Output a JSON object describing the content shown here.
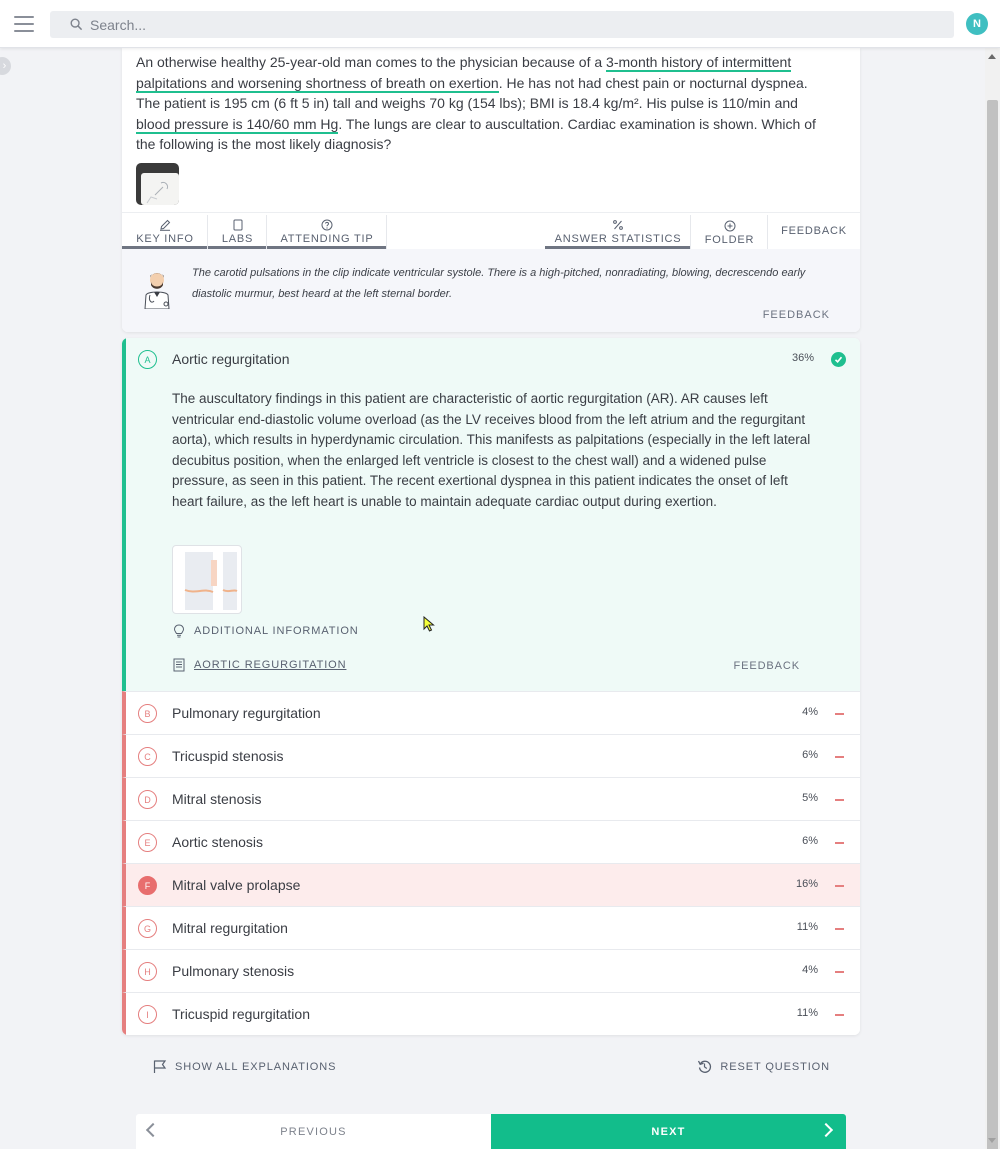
{
  "search": {
    "placeholder": "Search..."
  },
  "user": {
    "initial": "N"
  },
  "question": {
    "stem_parts": [
      "An otherwise healthy 25-year-old man comes to the physician because of a ",
      "3-month history of intermittent palpitations and worsening shortness of breath on exertion",
      ". He has not had chest pain or nocturnal dyspnea. The patient is 195 cm (6 ft 5 in) tall and weighs 70 kg (154 lbs); BMI is 18.4 kg/m². His pulse is 110/min and ",
      "blood pressure is 140/60 mm Hg",
      ". The lungs are clear to auscultation. Cardiac examination is shown. Which of the following is the most likely diagnosis?"
    ]
  },
  "tabs": {
    "key_info": "KEY INFO",
    "labs": "LABS",
    "attending_tip": "ATTENDING TIP",
    "answer_statistics": "ANSWER STATISTICS",
    "folder": "FOLDER",
    "feedback": "FEEDBACK"
  },
  "attending_tip": {
    "text": "The carotid pulsations in the clip indicate ventricular systole. There is a high-pitched, nonradiating, blowing, decrescendo early diastolic murmur, best heard at the left sternal border.",
    "feedback": "FEEDBACK"
  },
  "correct_answer": {
    "letter": "A",
    "label": "Aortic regurgitation",
    "percent": "36%",
    "explanation": "The auscultatory findings in this patient are characteristic of aortic regurgitation (AR). AR causes left ventricular end-diastolic volume overload (as the LV receives blood from the left atrium and the regurgitant aorta), which results in hyperdynamic circulation. This manifests as palpitations (especially in the left lateral decubitus position, when the enlarged left ventricle is closest to the chest wall) and a widened pulse pressure, as seen in this patient. The recent exertional dyspnea in this patient indicates the onset of left heart failure, as the left heart is unable to maintain adequate cardiac output during exertion.",
    "additional_info": "ADDITIONAL INFORMATION",
    "article_link": "AORTIC REGURGITATION",
    "feedback": "FEEDBACK"
  },
  "answers": [
    {
      "letter": "B",
      "label": "Pulmonary regurgitation",
      "percent": "4%"
    },
    {
      "letter": "C",
      "label": "Tricuspid stenosis",
      "percent": "6%"
    },
    {
      "letter": "D",
      "label": "Mitral stenosis",
      "percent": "5%"
    },
    {
      "letter": "E",
      "label": "Aortic stenosis",
      "percent": "6%"
    },
    {
      "letter": "F",
      "label": "Mitral valve prolapse",
      "percent": "16%"
    },
    {
      "letter": "G",
      "label": "Mitral regurgitation",
      "percent": "11%"
    },
    {
      "letter": "H",
      "label": "Pulmonary stenosis",
      "percent": "4%"
    },
    {
      "letter": "I",
      "label": "Tricuspid regurgitation",
      "percent": "11%"
    }
  ],
  "selected_answer": "F",
  "actions": {
    "show_all": "SHOW ALL EXPLANATIONS",
    "reset": "RESET QUESTION",
    "previous": "PREVIOUS",
    "next": "NEXT"
  },
  "colors": {
    "accent_green": "#1fbf8f",
    "next_button": "#12bd8b",
    "wrong_red": "#e57f7f",
    "selected_bg": "#fdecec",
    "correct_bg": "#effaf7",
    "avatar": "#3fbfc1"
  },
  "icons": {
    "menu": "hamburger-icon",
    "search": "search-icon",
    "key_info": "pencil-icon",
    "labs": "clipboard-icon",
    "attending_tip": "question-circle-icon",
    "answer_statistics": "percent-icon",
    "folder": "plus-circle-icon",
    "check": "check-circle-icon",
    "additional_info": "lightbulb-icon",
    "article": "document-icon",
    "show_all": "flag-icon",
    "reset": "reset-icon"
  }
}
